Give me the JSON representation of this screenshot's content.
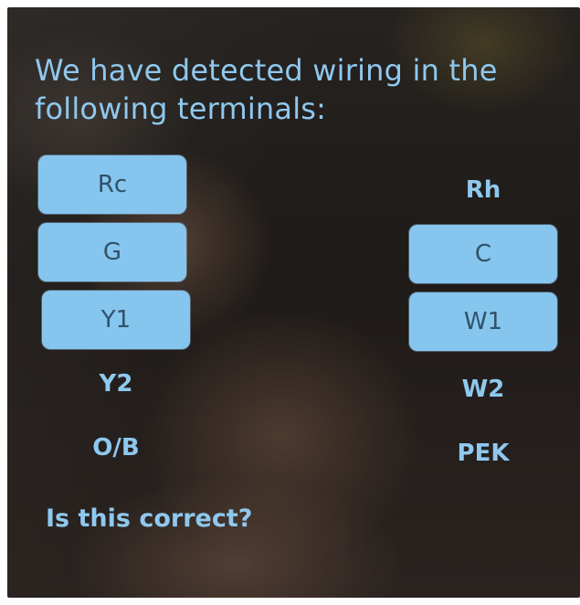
{
  "header": {
    "line1": "We have detected wiring in the",
    "line2": "following terminals:"
  },
  "terminals": {
    "left": [
      {
        "label": "Rc",
        "detected": true
      },
      {
        "label": "G",
        "detected": true
      },
      {
        "label": "Y1",
        "detected": true
      },
      {
        "label": "Y2",
        "detected": false
      },
      {
        "label": "O/B",
        "detected": false
      }
    ],
    "right": [
      {
        "label": "Rh",
        "detected": false
      },
      {
        "label": "C",
        "detected": true
      },
      {
        "label": "W1",
        "detected": true
      },
      {
        "label": "W2",
        "detected": false
      },
      {
        "label": "PEK",
        "detected": false
      }
    ]
  },
  "footer": {
    "question": "Is this correct?"
  },
  "colors": {
    "accent": "#86c5ee",
    "text": "#8fc8ee",
    "selected_text": "#2f5269"
  }
}
